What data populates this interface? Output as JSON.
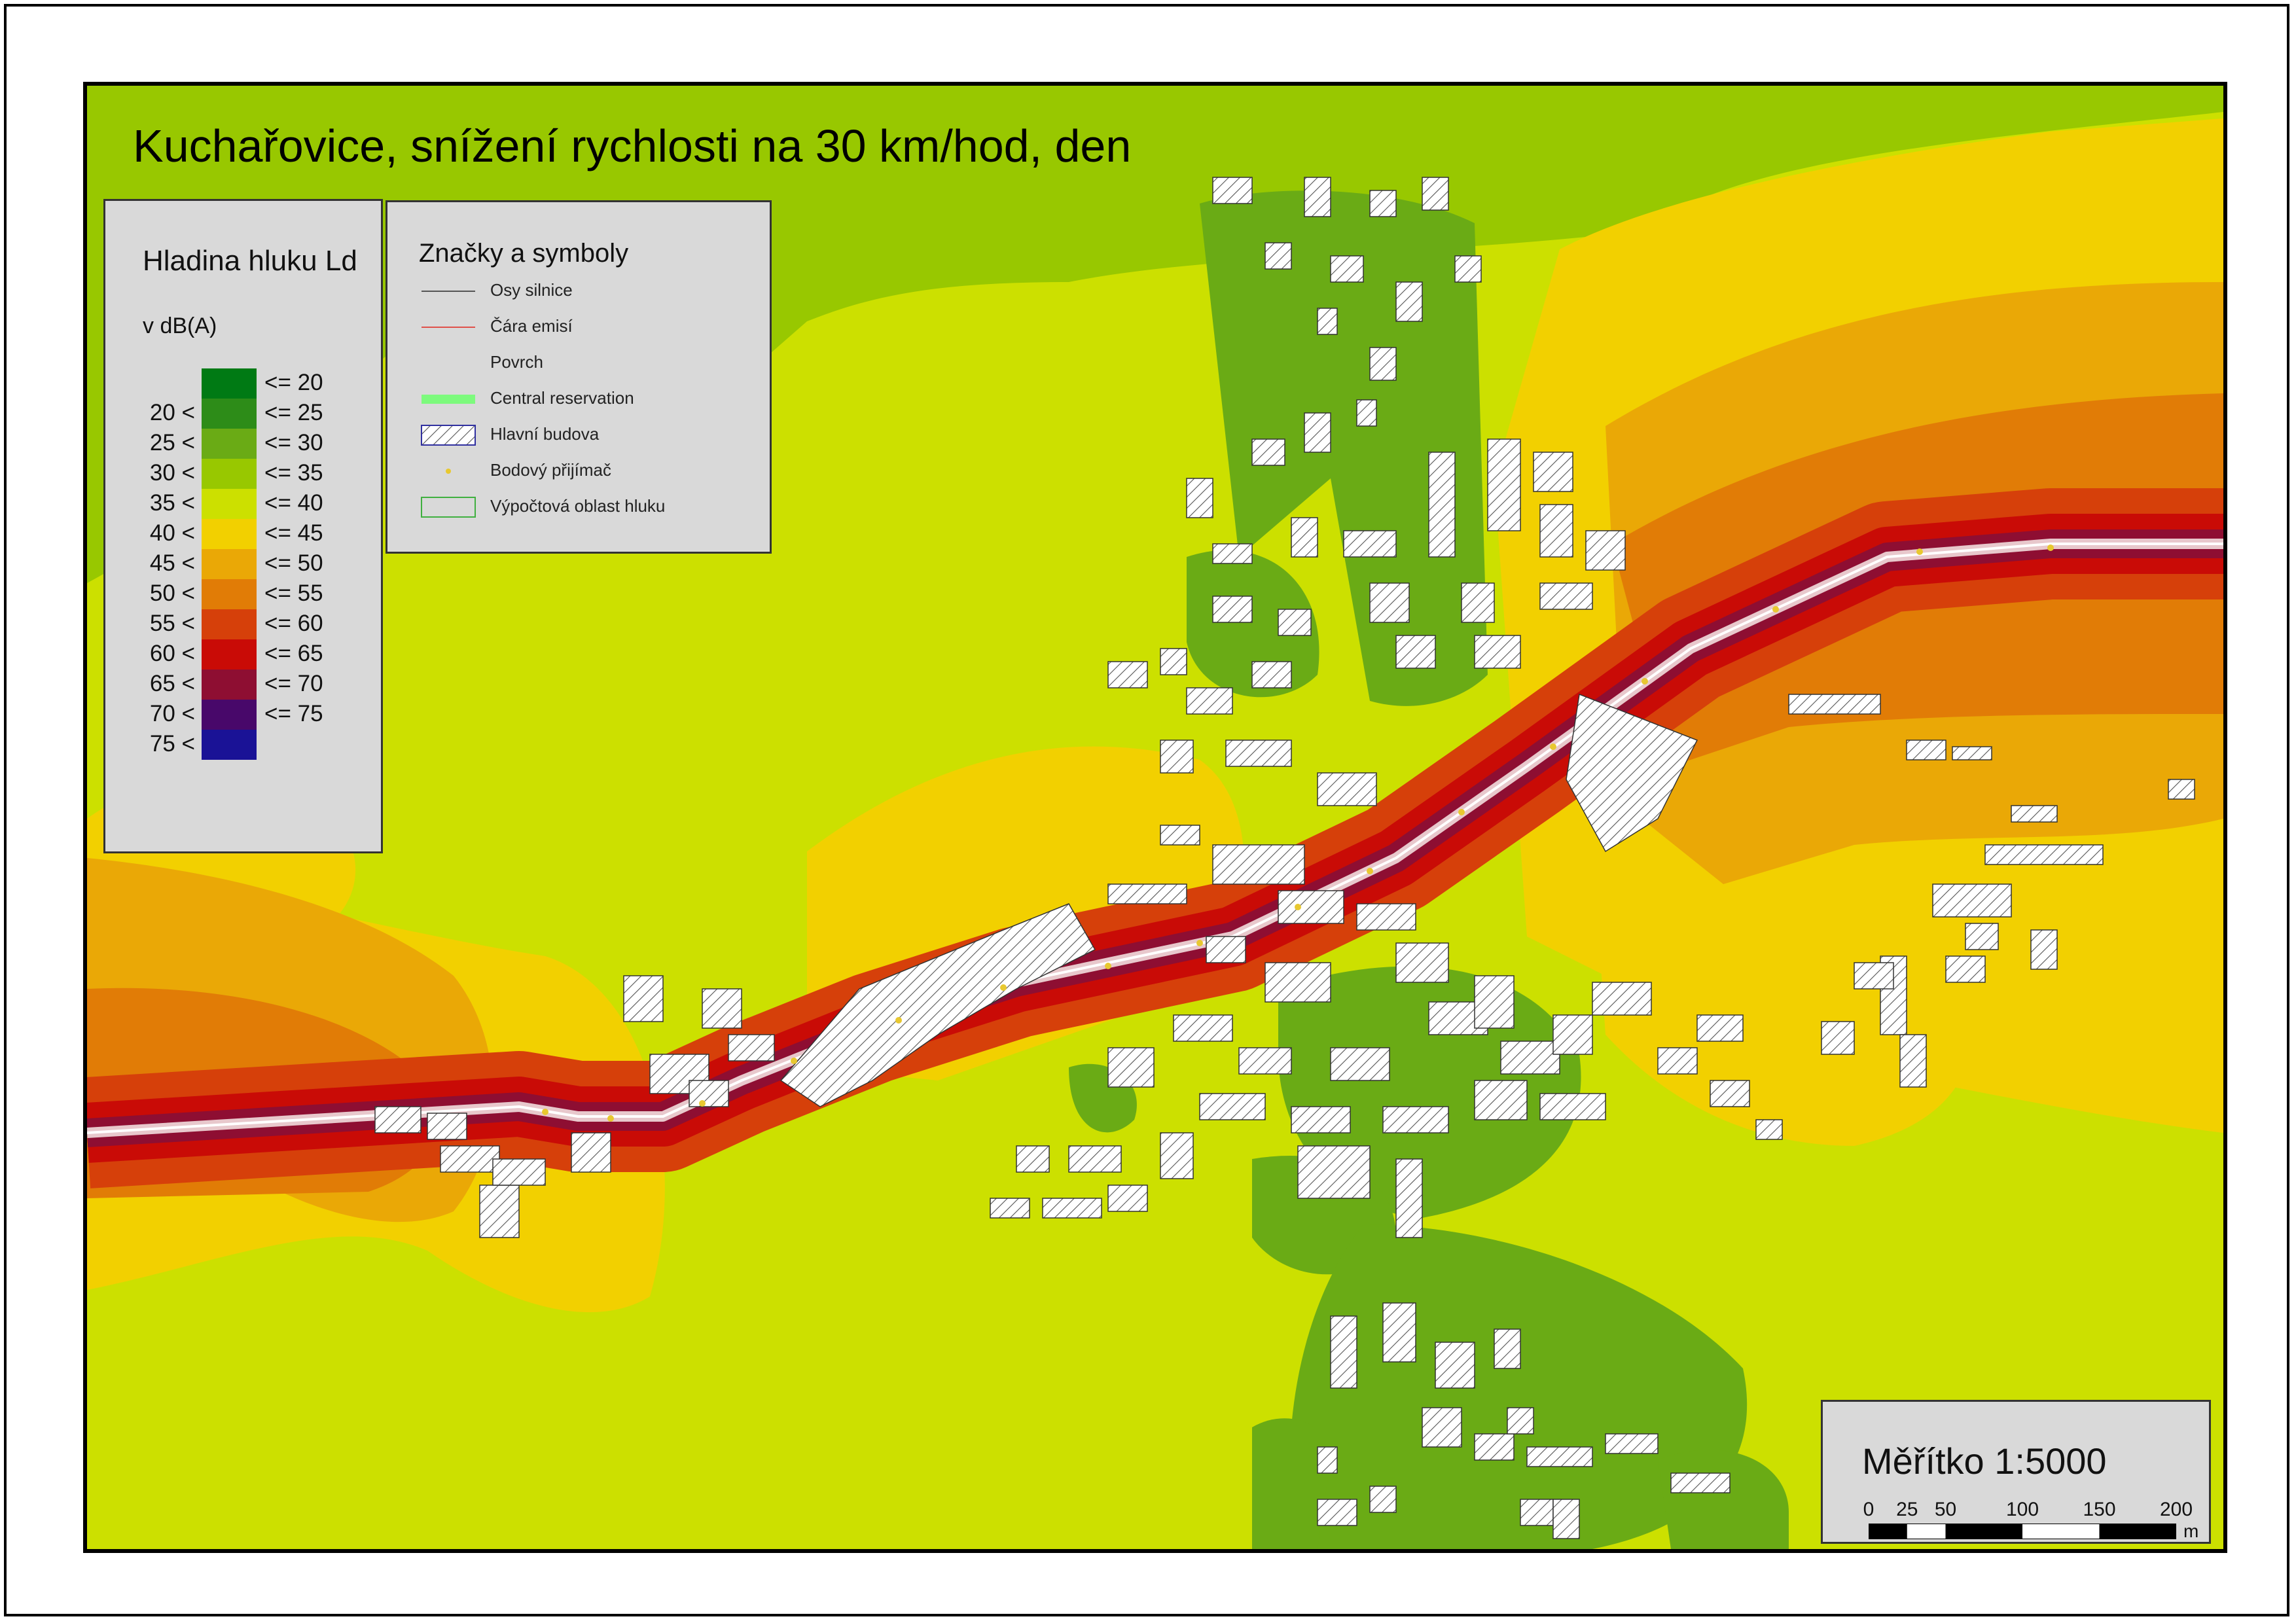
{
  "title": "Kuchařovice, snížení rychlosti na 30 km/hod, den",
  "legend": {
    "title": "Hladina hluku Ld",
    "unit": "v dB(A)",
    "classes": [
      {
        "lo": "",
        "hi": "<= 20",
        "color": "#007a14"
      },
      {
        "lo": "20 <",
        "hi": "<= 25",
        "color": "#2d8c18"
      },
      {
        "lo": "25 <",
        "hi": "<= 30",
        "color": "#6aab15"
      },
      {
        "lo": "30 <",
        "hi": "<= 35",
        "color": "#98c800"
      },
      {
        "lo": "35 <",
        "hi": "<= 40",
        "color": "#cce000"
      },
      {
        "lo": "40 <",
        "hi": "<= 45",
        "color": "#f2d000"
      },
      {
        "lo": "45 <",
        "hi": "<= 50",
        "color": "#eaa806"
      },
      {
        "lo": "50 <",
        "hi": "<= 55",
        "color": "#e17c06"
      },
      {
        "lo": "55 <",
        "hi": "<= 60",
        "color": "#d6400a"
      },
      {
        "lo": "60 <",
        "hi": "<= 65",
        "color": "#c90b06"
      },
      {
        "lo": "65 <",
        "hi": "<= 70",
        "color": "#8e0e32"
      },
      {
        "lo": "70 <",
        "hi": "<= 75",
        "color": "#48086a"
      },
      {
        "lo": "75 <",
        "hi": "",
        "color": "#1a1296"
      }
    ]
  },
  "symbols": {
    "title": "Značky a symboly",
    "items": [
      {
        "label": "Osy silnice",
        "kind": "line",
        "color": "#555555"
      },
      {
        "label": "Čára emisí",
        "kind": "line",
        "color": "#e0504a"
      },
      {
        "label": "Povrch",
        "kind": "none",
        "color": ""
      },
      {
        "label": "Central reservation",
        "kind": "fill",
        "color": "#7dfa7d"
      },
      {
        "label": "Hlavní budova",
        "kind": "hatch",
        "color": "#3030a0"
      },
      {
        "label": "Bodový přijímač",
        "kind": "point",
        "color": "#e8c830"
      },
      {
        "label": "Výpočtová oblast hluku",
        "kind": "outline",
        "color": "#40b040"
      }
    ]
  },
  "scale": {
    "label": "Měřítko 1:5000",
    "ticks": [
      "0",
      "25",
      "50",
      "100",
      "150",
      "200"
    ],
    "unit": "m"
  }
}
